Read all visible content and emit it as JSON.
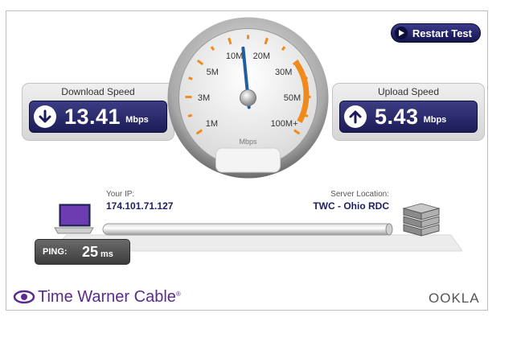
{
  "toolbar": {
    "restart_label": "Restart Test",
    "restart_icon": "restart-icon"
  },
  "download": {
    "title": "Download Speed",
    "value": "13.41",
    "unit": "Mbps",
    "icon": "arrow-down-icon"
  },
  "upload": {
    "title": "Upload Speed",
    "value": "5.43",
    "unit": "Mbps",
    "icon": "arrow-up-icon"
  },
  "gauge": {
    "unit_label": "Mbps",
    "ticks": [
      "1M",
      "3M",
      "5M",
      "10M",
      "20M",
      "30M",
      "50M",
      "100M+"
    ],
    "needle_value_mbps": 13.41,
    "colors": {
      "accent": "#f08a1c",
      "needle": "#1f5f9f"
    }
  },
  "network": {
    "ip_label": "Your IP:",
    "ip_value": "174.101.71.127",
    "server_label": "Server Location:",
    "server_value": "TWC - Ohio RDC"
  },
  "ping": {
    "label": "PING:",
    "value": "25",
    "unit": "ms"
  },
  "footer": {
    "brand": "Time Warner Cable",
    "brand_mark": "®",
    "partner": "OOKLA"
  },
  "colors": {
    "panel_blue": "#1c1c58",
    "brand_purple": "#5a2a8f"
  }
}
